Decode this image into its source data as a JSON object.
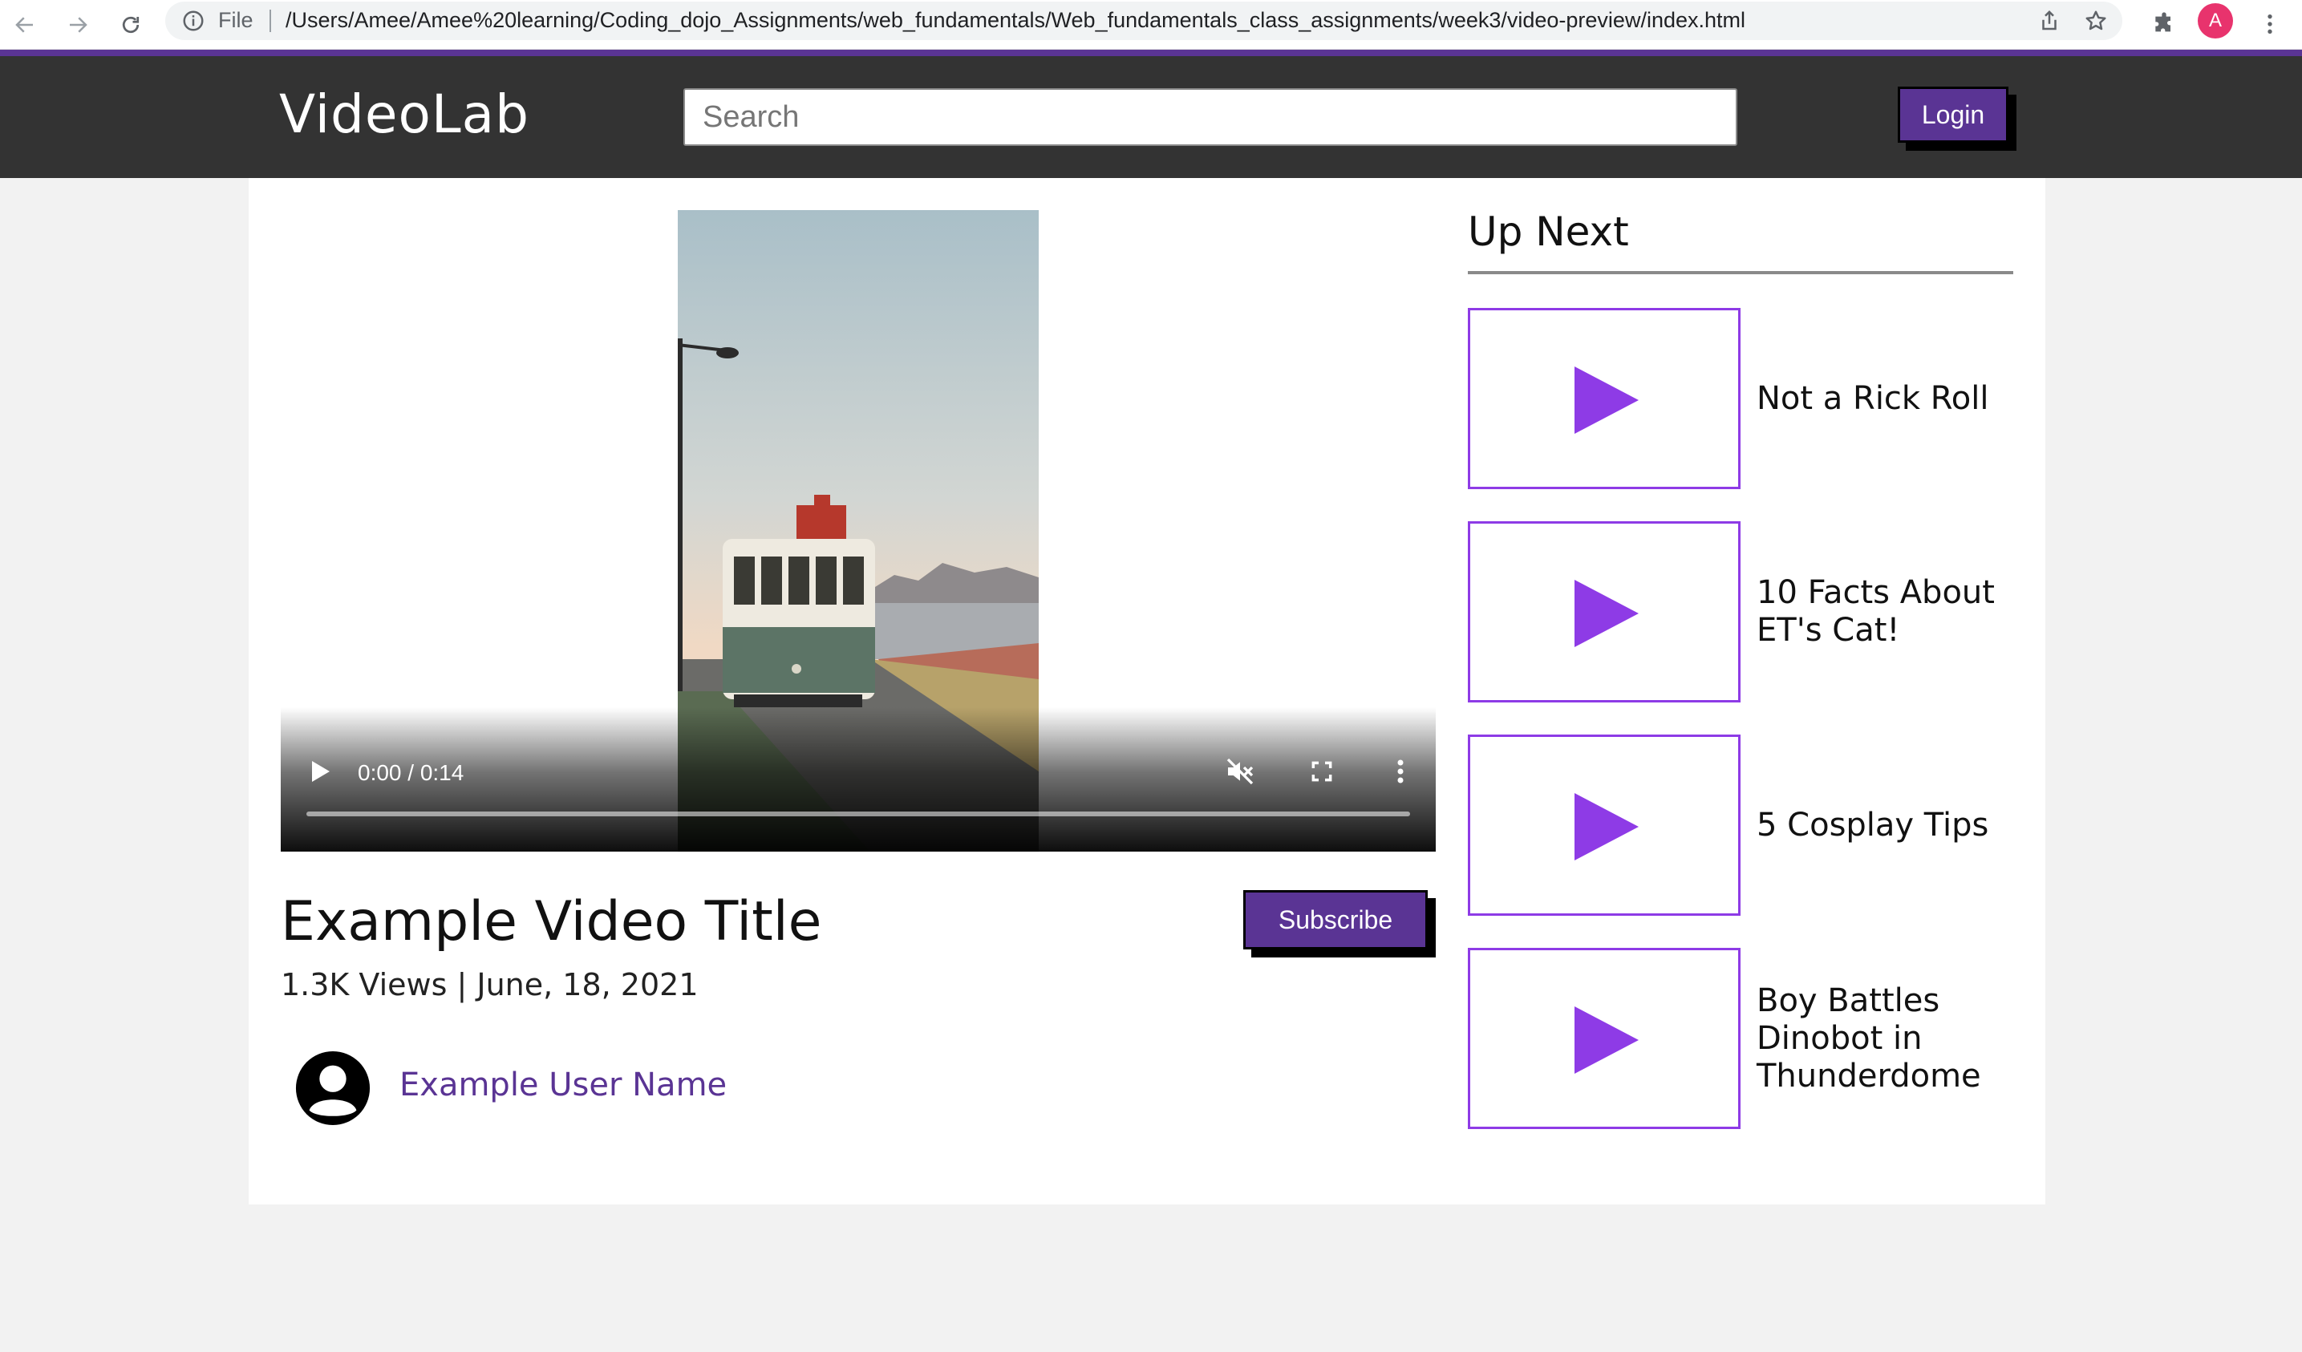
{
  "browser": {
    "scheme_label": "File",
    "url": "/Users/Amee/Amee%20learning/Coding_dojo_Assignments/web_fundamentals/Web_fundamentals_class_assignments/week3/video-preview/index.html",
    "profile_initial": "A"
  },
  "header": {
    "logo": "VideoLab",
    "search_placeholder": "Search",
    "login_label": "Login"
  },
  "player": {
    "time": "0:00 / 0:14",
    "progress": 0
  },
  "video": {
    "title": "Example Video Title",
    "meta": "1.3K Views | June, 18, 2021",
    "subscribe_label": "Subscribe",
    "user_name": "Example User Name"
  },
  "sidebar": {
    "heading": "Up Next",
    "items": [
      {
        "label": "Not a Rick Roll"
      },
      {
        "label": "10 Facts About ET's Cat!"
      },
      {
        "label": "5 Cosplay Tips"
      },
      {
        "label": "Boy Battles Dinobot in Thunderdome"
      }
    ]
  },
  "colors": {
    "brand": "#5a3494",
    "play_icon": "#8e3be6",
    "header_bg": "#333333"
  }
}
